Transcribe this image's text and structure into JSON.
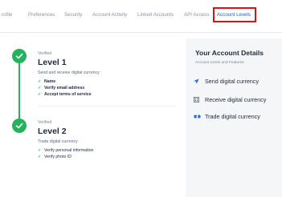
{
  "tabs": [
    {
      "label": "rofile"
    },
    {
      "label": "Preferences"
    },
    {
      "label": "Security"
    },
    {
      "label": "Account Activity"
    },
    {
      "label": "Linked Accounts"
    },
    {
      "label": "API Access"
    },
    {
      "label": "Account Levels",
      "active": true
    }
  ],
  "levels": [
    {
      "status": "Verified",
      "title": "Level 1",
      "description": "Send and receive digital currency",
      "requirements": [
        "Name",
        "Verify email address",
        "Accept terms of service"
      ]
    },
    {
      "status": "Verified",
      "title": "Level 2",
      "description": "Trade digital currency",
      "requirements": [
        "Verify personal information",
        "Verify photo ID"
      ]
    }
  ],
  "details": {
    "title": "Your Account Details",
    "subtitle": "Account Limits and Features",
    "items": [
      {
        "label": "Send digital currency",
        "icon": "send-icon"
      },
      {
        "label": "Receive digital currency",
        "icon": "receive-icon"
      },
      {
        "label": "Trade digital currency",
        "icon": "trade-icon"
      }
    ]
  },
  "colors": {
    "accent": "#1f5fc6",
    "verified": "#24b35c",
    "highlight": "#d01818"
  }
}
